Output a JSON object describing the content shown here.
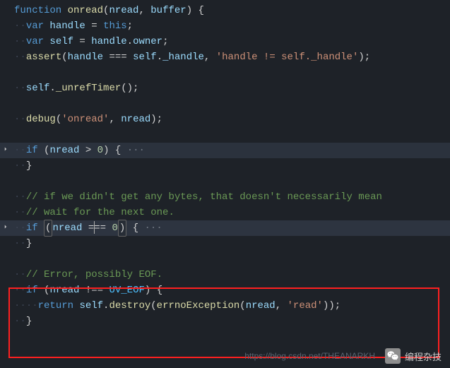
{
  "code": {
    "l1": {
      "kw_fn": "function ",
      "name": "onread",
      "p1": "(",
      "a1": "nread",
      "c": ", ",
      "a2": "buffer",
      "p2": ") {"
    },
    "l2": {
      "kw": "var ",
      "v": "handle",
      "eq": " = ",
      "th": "this",
      "sc": ";"
    },
    "l3": {
      "kw": "var ",
      "v": "self",
      "eq": " = ",
      "h": "handle",
      "d": ".",
      "o": "owner",
      "sc": ";"
    },
    "l4": {
      "fn": "assert",
      "p1": "(",
      "h": "handle",
      "op": " === ",
      "s": "self",
      "d": ".",
      "hd": "_handle",
      "c": ", ",
      "str": "'handle != self._handle'",
      "p2": ");"
    },
    "l5": {},
    "l6": {
      "s": "self",
      "d": ".",
      "fn": "_unrefTimer",
      "p": "();"
    },
    "l7": {},
    "l8": {
      "fn": "debug",
      "p1": "(",
      "str": "'onread'",
      "c": ", ",
      "n": "nread",
      "p2": ");"
    },
    "l9": {},
    "l10": {
      "kw": "if ",
      "p1": "(",
      "n": "nread",
      "op": " > ",
      "num": "0",
      "p2": ") {",
      "fold": " ···"
    },
    "l11": {
      "b": "}"
    },
    "l12": {},
    "l13": {
      "c": "// if we didn't get any bytes, that doesn't necessarily mean "
    },
    "l14": {
      "c": "// wait for the next one."
    },
    "l15": {
      "kw": "if ",
      "p1": "(",
      "n": "nread",
      "op1": " =",
      "op2": "== ",
      "num": "0",
      "p2": ")",
      "b": " {",
      "fold": " ···"
    },
    "l16": {
      "b": "}"
    },
    "l17": {},
    "l18": {
      "c": "// Error, possibly EOF."
    },
    "l19": {
      "kw": "if ",
      "p1": "(",
      "n": "nread",
      "op": " !== ",
      "cn": "UV_EOF",
      "p2": ") {"
    },
    "l20": {
      "kw": "return ",
      "s": "self",
      "d": ".",
      "fn": "destroy",
      "p1": "(",
      "fn2": "errnoException",
      "p2": "(",
      "n": "nread",
      "c": ", ",
      "str": "'read'",
      "p3": "));"
    },
    "l21": {
      "b": "}"
    }
  },
  "watermark": {
    "url": "https://blog.csdn.net/THEANARKH",
    "label": "编程杂技"
  }
}
